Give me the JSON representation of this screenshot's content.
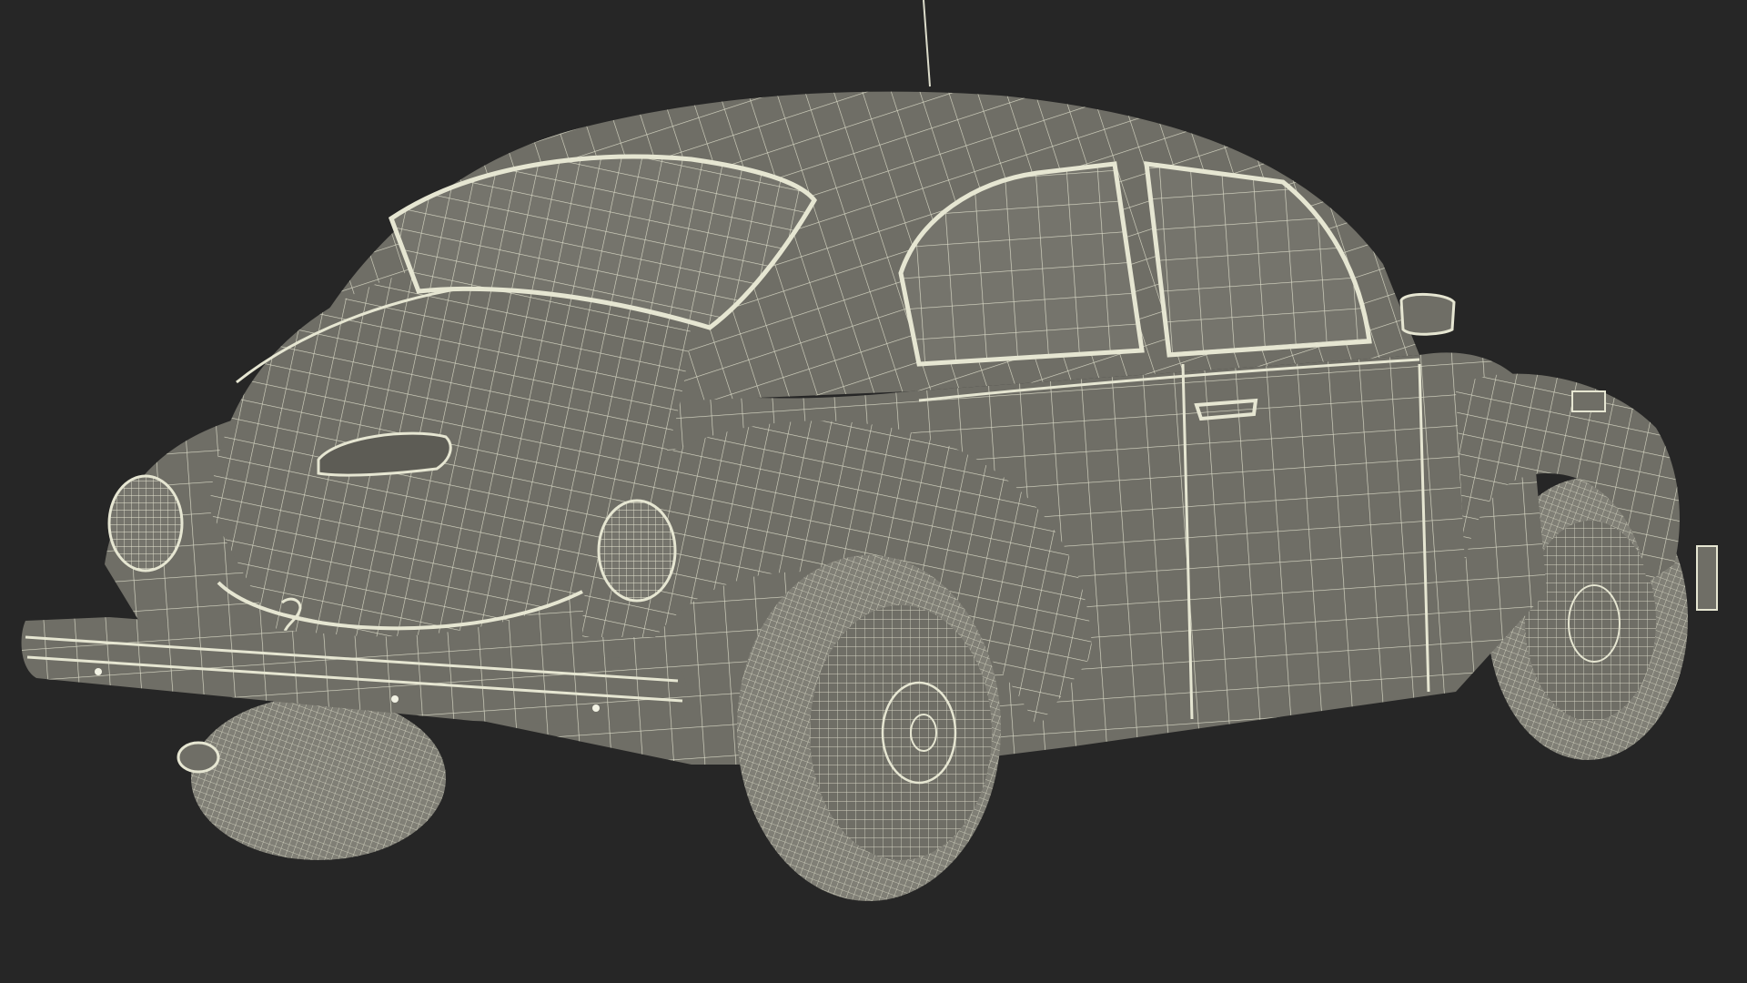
{
  "scene": {
    "subject": "car-wireframe-model",
    "colors": {
      "background": "#262626",
      "body_fill": "#6f6e66",
      "wire": "#e6e6d2"
    }
  }
}
